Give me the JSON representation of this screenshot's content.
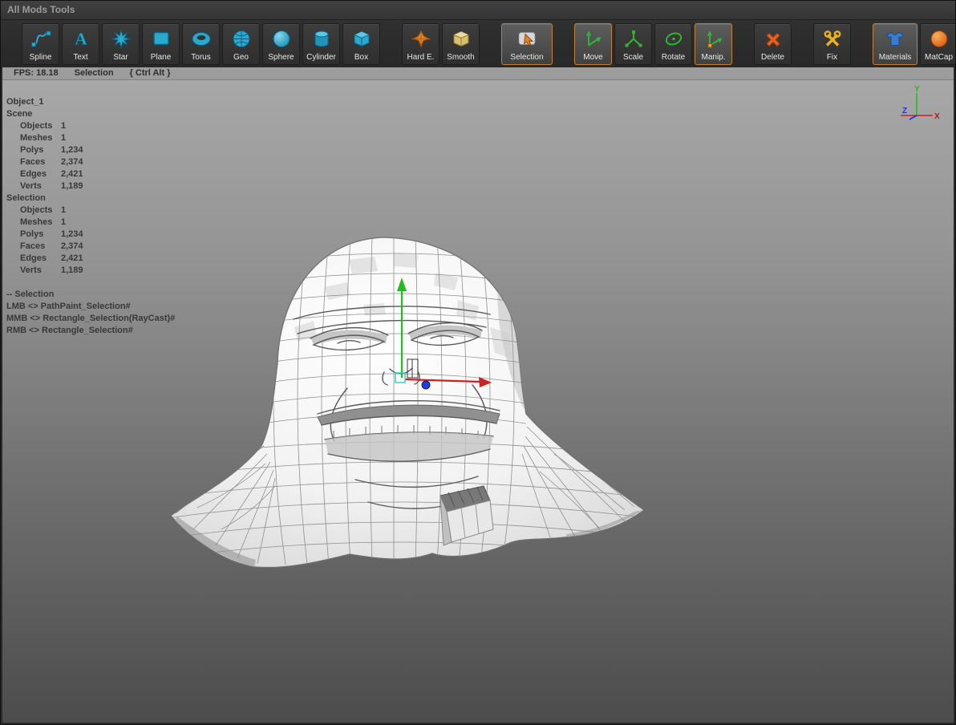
{
  "window": {
    "title": "All Mods Tools"
  },
  "toolbar": {
    "buttons": [
      {
        "label": "Spline",
        "icon": "spline-icon",
        "active": false
      },
      {
        "label": "Text",
        "icon": "text-icon",
        "active": false
      },
      {
        "label": "Star",
        "icon": "star-icon",
        "active": false
      },
      {
        "label": "Plane",
        "icon": "plane-icon",
        "active": false
      },
      {
        "label": "Torus",
        "icon": "torus-icon",
        "active": false
      },
      {
        "label": "Geo",
        "icon": "geo-icon",
        "active": false
      },
      {
        "label": "Sphere",
        "icon": "sphere-icon",
        "active": false
      },
      {
        "label": "Cylinder",
        "icon": "cylinder-icon",
        "active": false
      },
      {
        "label": "Box",
        "icon": "box-icon",
        "active": false
      },
      {
        "label": "Hard E.",
        "icon": "hard-edge-icon",
        "active": false
      },
      {
        "label": "Smooth",
        "icon": "smooth-icon",
        "active": false
      },
      {
        "label": "Selection",
        "icon": "selection-icon",
        "active": true
      },
      {
        "label": "Move",
        "icon": "move-icon",
        "active": true
      },
      {
        "label": "Scale",
        "icon": "scale-icon",
        "active": false
      },
      {
        "label": "Rotate",
        "icon": "rotate-icon",
        "active": false
      },
      {
        "label": "Manip.",
        "icon": "manip-icon",
        "active": true
      },
      {
        "label": "Delete",
        "icon": "delete-icon",
        "active": false
      },
      {
        "label": "Fix",
        "icon": "fix-icon",
        "active": false
      },
      {
        "label": "Materials",
        "icon": "materials-icon",
        "active": true
      },
      {
        "label": "MatCap",
        "icon": "matcap-icon",
        "active": false
      }
    ]
  },
  "statusbar": {
    "fps": "FPS: 18.18",
    "mode": "Selection",
    "modifiers": "{ Ctrl Alt }"
  },
  "stats": {
    "object_name": "Object_1",
    "scene_title": "Scene",
    "scene_rows": [
      {
        "label": "Objects",
        "value": "1"
      },
      {
        "label": "Meshes",
        "value": "1"
      },
      {
        "label": "Polys",
        "value": "1,234"
      },
      {
        "label": "Faces",
        "value": "2,374"
      },
      {
        "label": "Edges",
        "value": "2,421"
      },
      {
        "label": "Verts",
        "value": "1,189"
      }
    ],
    "selection_title": "Selection",
    "selection_rows": [
      {
        "label": "Objects",
        "value": "1"
      },
      {
        "label": "Meshes",
        "value": "1"
      },
      {
        "label": "Polys",
        "value": "1,234"
      },
      {
        "label": "Faces",
        "value": "2,374"
      },
      {
        "label": "Edges",
        "value": "2,421"
      },
      {
        "label": "Verts",
        "value": "1,189"
      }
    ],
    "bindings_title": "-- Selection",
    "bindings": [
      "LMB <> PathPaint_Selection#",
      "MMB <> Rectangle_Selection(RayCast)#",
      "RMB <> Rectangle_Selection#"
    ]
  },
  "axis_gizmo": {
    "x": "X",
    "y": "Y",
    "z": "Z"
  },
  "colors": {
    "accent_orange_border": "#c0803a",
    "icon_cyan": "#2aa9ce",
    "icon_green": "#2fb52f",
    "icon_orange": "#e8641e",
    "icon_yellow": "#eab31e",
    "icon_blue": "#3a7bd0",
    "gizmo_x_red": "#cc2222",
    "gizmo_y_green": "#22bb22",
    "gizmo_z_blue": "#2233cc"
  }
}
